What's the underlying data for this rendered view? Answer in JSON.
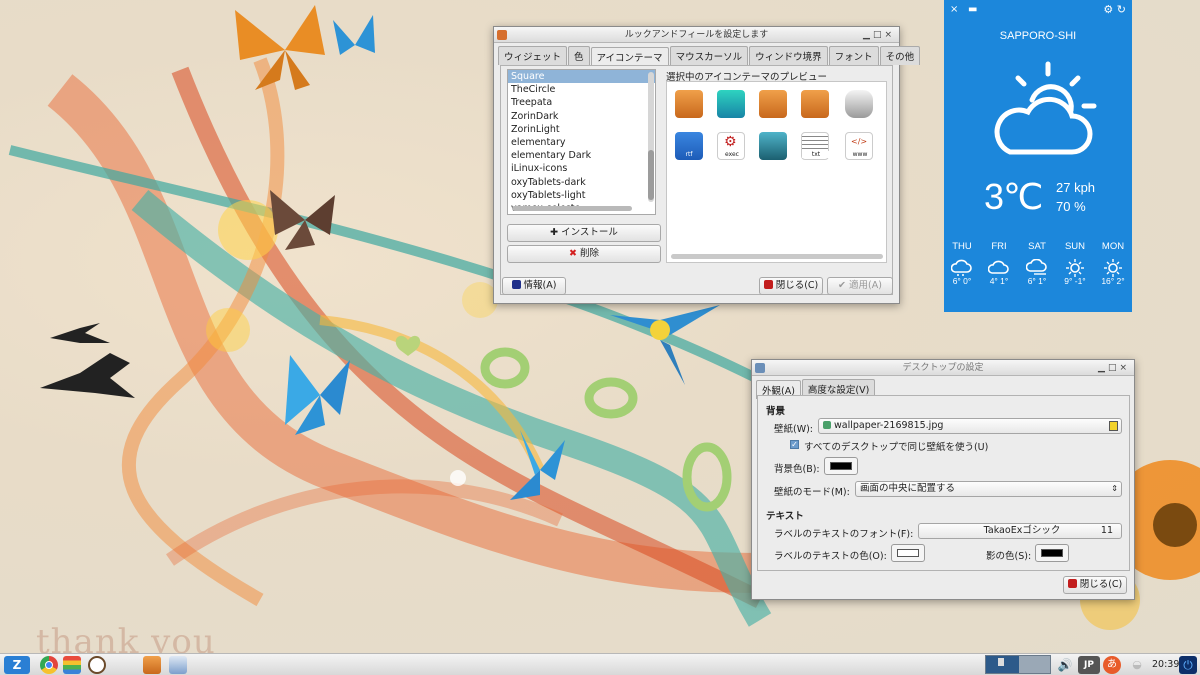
{
  "look_and_feel": {
    "title": "ルックアンドフィールを設定します",
    "tabs": [
      "ウィジェット",
      "色",
      "アイコンテーマ",
      "マウスカーソル",
      "ウィンドウ境界",
      "フォント",
      "その他"
    ],
    "themes": [
      "Square",
      "TheCircle",
      "Treepata",
      "ZorinDark",
      "ZorinLight",
      "elementary",
      "elementary Dark",
      "iLinux-icons",
      "oxyTablets-dark",
      "oxyTablets-light",
      "vamox-celeste"
    ],
    "preview_label": "選択中のアイコンテーマのプレビュー",
    "install_label": "インストール",
    "delete_label": "削除",
    "info_label": "情報(A)",
    "close_label": "閉じる(C)",
    "apply_label": "適用(A)",
    "tile_labels": [
      "rtf",
      "exec",
      "",
      "txt",
      "www"
    ]
  },
  "desktop_settings": {
    "title": "デスクトップの設定",
    "tabs": [
      "外観(A)",
      "高度な設定(V)"
    ],
    "bg_section": "背景",
    "wallpaper_label": "壁紙(W):",
    "wallpaper_value": "wallpaper-2169815.jpg",
    "same_wallpaper_label": "すべてのデスクトップで同じ壁紙を使う(U)",
    "bg_color_label": "背景色(B):",
    "mode_label": "壁紙のモード(M):",
    "mode_value": "画面の中央に配置する",
    "text_section": "テキスト",
    "font_label": "ラベルのテキストのフォント(F):",
    "font_value": "TakaoExゴシック",
    "font_size": "11",
    "text_color_label": "ラベルのテキストの色(O):",
    "shadow_label": "影の色(S):",
    "close_label": "閉じる(C)"
  },
  "weather": {
    "city": "SAPPORO-SHI",
    "temp": "3℃",
    "wind": "27 kph",
    "humidity": "70 %",
    "forecast": [
      {
        "day": "THU",
        "range": "6° 0°",
        "icon": "snow-cloud-icon"
      },
      {
        "day": "FRI",
        "range": "4° 1°",
        "icon": "cloud-icon"
      },
      {
        "day": "SAT",
        "range": "6° 1°",
        "icon": "wind-cloud-icon"
      },
      {
        "day": "SUN",
        "range": "9° -1°",
        "icon": "sun-icon"
      },
      {
        "day": "MON",
        "range": "16° 2°",
        "icon": "sun-icon"
      }
    ]
  },
  "wallpaper_text": "thank you",
  "taskbar": {
    "lang": "JP",
    "ime": "あ",
    "time": "20:39"
  }
}
